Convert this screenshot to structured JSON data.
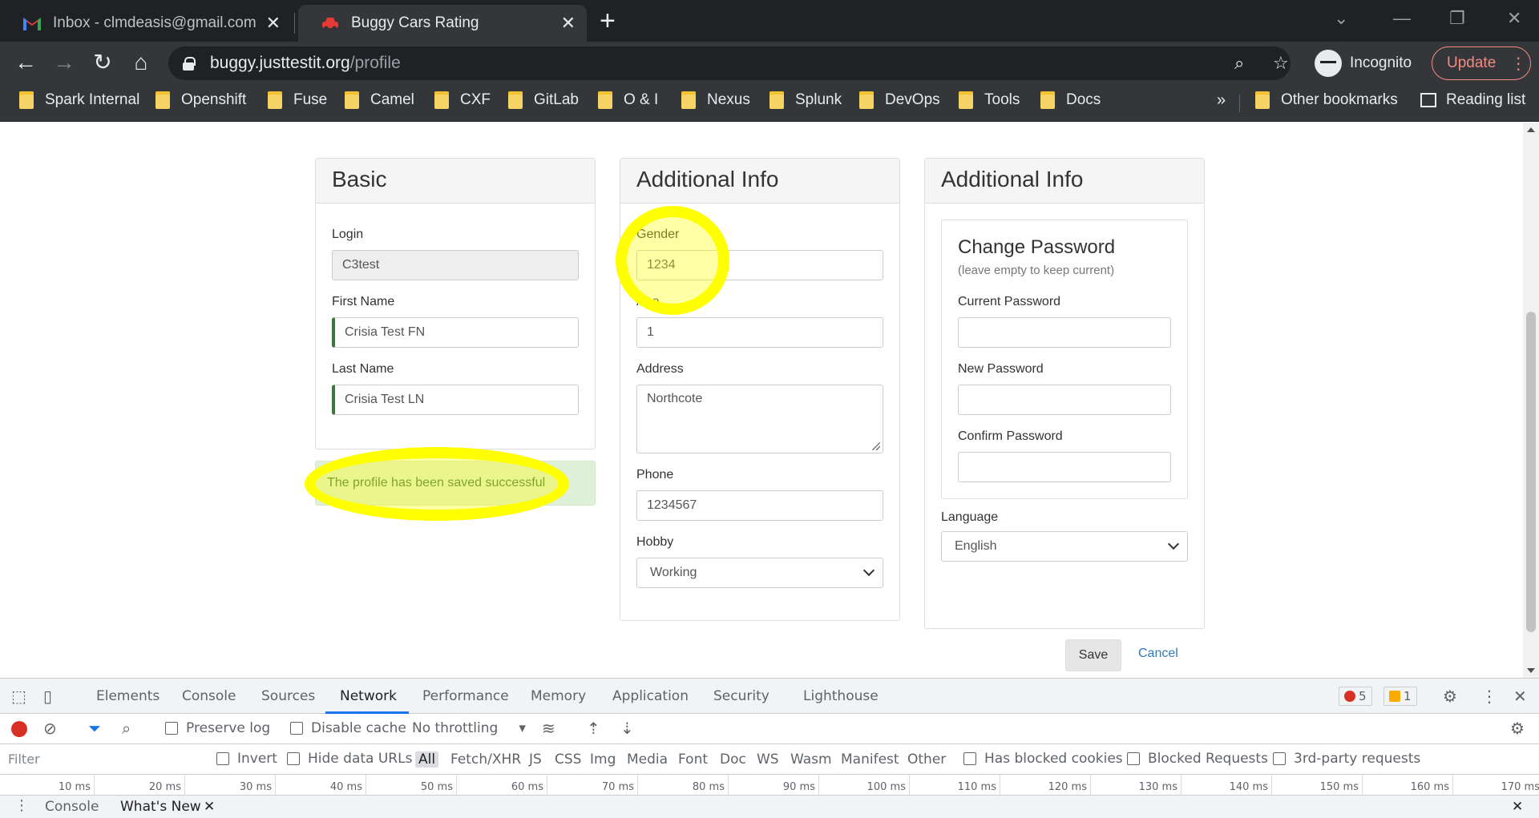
{
  "browser": {
    "tabs": [
      {
        "title": "Inbox - clmdeasis@gmail.com - G",
        "active": false,
        "favicon": "gmail-icon"
      },
      {
        "title": "Buggy Cars Rating",
        "active": true,
        "favicon": "car-icon"
      }
    ],
    "url_host": "buggy.justtestit.org",
    "url_path": "/profile",
    "incognito_label": "Incognito",
    "update_label": "Update",
    "bookmarks": [
      "Spark Internal",
      "Openshift",
      "Fuse",
      "Camel",
      "CXF",
      "GitLab",
      "O & I",
      "Nexus",
      "Splunk",
      "DevOps",
      "Tools",
      "Docs"
    ],
    "bookmarks_overflow": "»",
    "other_bookmarks": "Other bookmarks",
    "reading_list": "Reading list"
  },
  "basic": {
    "heading": "Basic",
    "login_label": "Login",
    "login_value": "C3test",
    "first_name_label": "First Name",
    "first_name_value": "Crisia Test FN",
    "last_name_label": "Last Name",
    "last_name_value": "Crisia Test LN",
    "success_message": "The profile has been saved successful"
  },
  "additional": {
    "heading": "Additional Info",
    "gender_label": "Gender",
    "gender_value": "1234",
    "age_label": "Age",
    "age_value": "1",
    "address_label": "Address",
    "address_value": "Northcote",
    "phone_label": "Phone",
    "phone_value": "1234567",
    "hobby_label": "Hobby",
    "hobby_value": "Working"
  },
  "password": {
    "heading": "Additional Info",
    "title": "Change Password",
    "subtitle": "(leave empty to keep current)",
    "current_label": "Current Password",
    "new_label": "New Password",
    "confirm_label": "Confirm Password",
    "language_label": "Language",
    "language_value": "English"
  },
  "actions": {
    "save": "Save",
    "cancel": "Cancel"
  },
  "devtools": {
    "tabs": [
      "Elements",
      "Console",
      "Sources",
      "Network",
      "Performance",
      "Memory",
      "Application",
      "Security",
      "Lighthouse"
    ],
    "active_tab": "Network",
    "errors": "5",
    "warnings": "1",
    "preserve_log": "Preserve log",
    "disable_cache": "Disable cache",
    "throttling": "No throttling",
    "filter_placeholder": "Filter",
    "invert": "Invert",
    "hide_data_urls": "Hide data URLs",
    "types": [
      "All",
      "Fetch/XHR",
      "JS",
      "CSS",
      "Img",
      "Media",
      "Font",
      "Doc",
      "WS",
      "Wasm",
      "Manifest",
      "Other"
    ],
    "has_blocked_cookies": "Has blocked cookies",
    "blocked_requests": "Blocked Requests",
    "third_party": "3rd-party requests",
    "ticks": [
      "10 ms",
      "20 ms",
      "30 ms",
      "40 ms",
      "50 ms",
      "60 ms",
      "70 ms",
      "80 ms",
      "90 ms",
      "100 ms",
      "110 ms",
      "120 ms",
      "130 ms",
      "140 ms",
      "150 ms",
      "160 ms",
      "170 ms"
    ],
    "drawer_tabs": [
      "Console",
      "What's New"
    ]
  }
}
